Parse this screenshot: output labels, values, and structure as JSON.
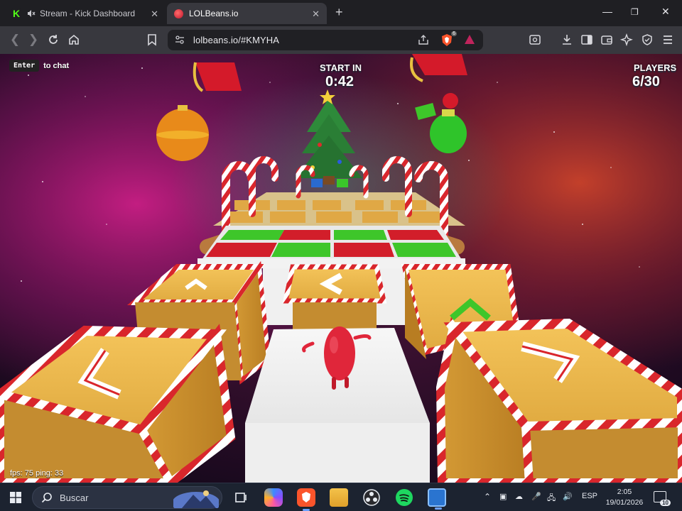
{
  "browser": {
    "tabs": [
      {
        "title": "Stream - Kick Dashboard",
        "favicon": "kick-icon",
        "muted": true,
        "active": false
      },
      {
        "title": "LOLBeans.io",
        "favicon": "lolbeans-icon",
        "muted": false,
        "active": true
      }
    ],
    "url": "lolbeans.io/#KMYHA",
    "brave_shield_count": "6",
    "window_controls": {
      "minimize": "—",
      "maximize": "❐",
      "close": "✕"
    }
  },
  "game": {
    "chat_key": "Enter",
    "chat_hint": "to chat",
    "start_label": "START IN",
    "start_time": "0:42",
    "players_label": "PLAYERS",
    "players_count": "6/30",
    "fps_text": "fps: 75 ping: 33",
    "colors": {
      "box_tan": "#e8b547",
      "stripe_red": "#d9262c",
      "stripe_white": "#ffffff",
      "green_tile": "#3ecf2a",
      "red_tile": "#d21e2a",
      "bean": "#e0263a"
    }
  },
  "taskbar": {
    "search_placeholder": "Buscar",
    "language": "ESP",
    "time": "2:05",
    "date": "19/01/2026",
    "notification_count": "10"
  }
}
